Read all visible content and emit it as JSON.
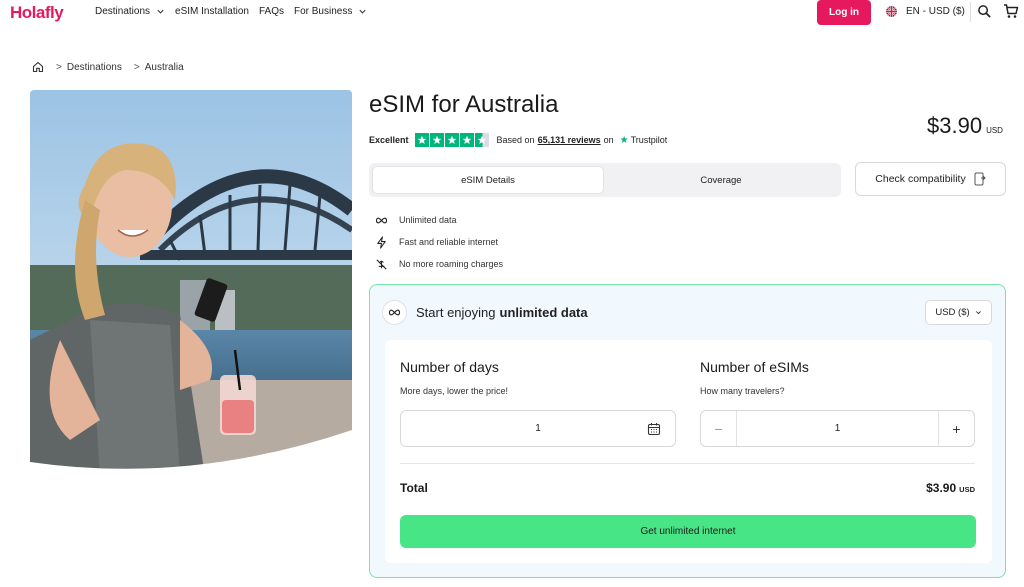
{
  "header": {
    "logo": "Holafly",
    "nav": [
      {
        "label": "Destinations",
        "has_dropdown": true
      },
      {
        "label": "eSIM Installation",
        "has_dropdown": false
      },
      {
        "label": "FAQs",
        "has_dropdown": false
      },
      {
        "label": "For Business",
        "has_dropdown": true
      }
    ],
    "login_label": "Log in",
    "language": "EN - USD ($)",
    "icons": [
      "uk-flag-icon",
      "search-icon",
      "cart-icon"
    ]
  },
  "breadcrumb": {
    "items": [
      "Destinations",
      "Australia"
    ],
    "separator": ">"
  },
  "product": {
    "title": "eSIM for Australia",
    "rating_label": "Excellent",
    "stars": 4.5,
    "based_on": "Based on",
    "reviews": "65,131 reviews",
    "on": "on",
    "trustpilot": "Trustpilot",
    "price": "$3.90",
    "currency": "USD"
  },
  "tabs": [
    {
      "label": "eSIM Details",
      "active": true
    },
    {
      "label": "Coverage",
      "active": false
    }
  ],
  "compat_label": "Check compatibility",
  "features": [
    {
      "icon": "infinity-icon",
      "label": "Unlimited data"
    },
    {
      "icon": "lightning-icon",
      "label": "Fast and reliable internet"
    },
    {
      "icon": "no-roaming-icon",
      "label": "No more roaming charges"
    }
  ],
  "card": {
    "head_prefix": "Start enjoying",
    "head_bold": "unlimited data",
    "currency_select": "USD ($)",
    "days": {
      "label": "Number of days",
      "sub": "More days, lower the price!",
      "value": "1"
    },
    "sims": {
      "label": "Number of eSIMs",
      "sub": "How many travelers?",
      "value": "1"
    },
    "total_label": "Total",
    "total_value": "$3.90",
    "total_currency": "USD",
    "cta": "Get unlimited internet"
  },
  "colors": {
    "brand": "#e6195e",
    "cta": "#48e586",
    "trustpilot": "#00b67a",
    "card_border": "#7be3a6",
    "card_bg": "#f1f8fe"
  }
}
